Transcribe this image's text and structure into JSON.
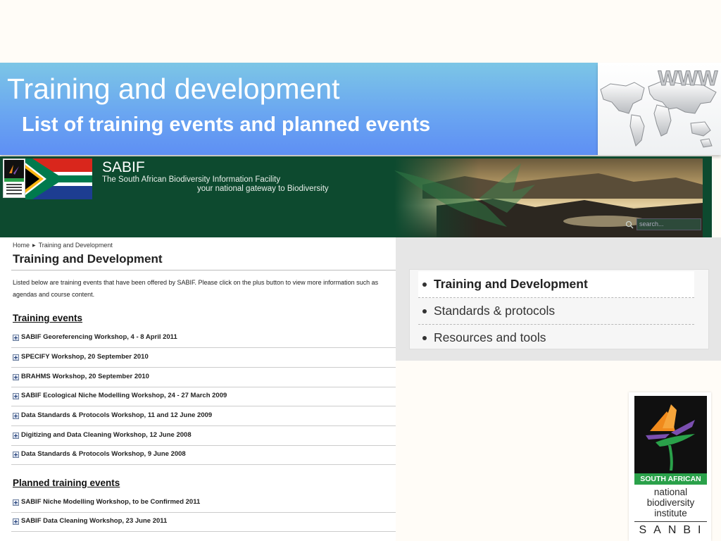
{
  "slide": {
    "title": "Training and development",
    "subtitle": "List of training  events and planned events",
    "globe_text": "WWW"
  },
  "sabif": {
    "name": "SABIF",
    "description": "The South African Biodiversity Information Facility",
    "tagline": "your national gateway to Biodiversity",
    "search_placeholder": "search...",
    "colors": {
      "header_bg": "#0d4a2f"
    }
  },
  "page": {
    "breadcrumb": [
      "Home",
      "Training and Development"
    ],
    "title": "Training and Development",
    "intro": "Listed below are training events that have been offered by SABIF. Please click on the plus button to view more information such as agendas and course content.",
    "training_heading": "Training events",
    "training_events": [
      "SABIF Georeferencing Workshop, 4 - 8 April 2011",
      "SPECIFY Workshop, 20 September 2010",
      "BRAHMS Workshop, 20 September 2010",
      "SABIF Ecological Niche Modelling Workshop, 24 - 27 March 2009",
      "Data Standards & Protocols Workshop, 11 and 12 June 2009",
      "Digitizing and Data Cleaning Workshop, 12 June 2008",
      "Data Standards & Protocols Workshop, 9 June 2008"
    ],
    "planned_heading": "Planned training events",
    "planned_events": [
      "SABIF Niche Modelling Workshop, to be Confirmed 2011",
      "SABIF Data Cleaning Workshop, 23 June 2011"
    ]
  },
  "menu": {
    "items": [
      "Training and Development",
      "Standards & protocols",
      "Resources and tools"
    ],
    "active_index": 0
  },
  "sanbi": {
    "band": "SOUTH AFRICAN",
    "lines": [
      "national",
      "biodiversity",
      "institute"
    ],
    "abbr": "SANBI",
    "colors": {
      "green": "#2aa14a",
      "orange": "#f08a1c",
      "purple": "#7b4fb0"
    }
  }
}
